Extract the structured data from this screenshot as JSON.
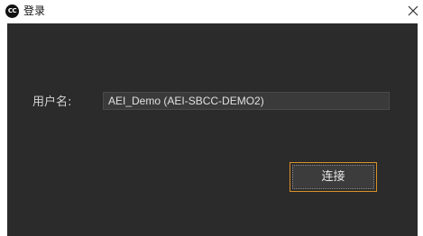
{
  "window": {
    "title": "登录",
    "app_icon_text": "CC",
    "close_icon": "close-icon"
  },
  "form": {
    "username_label": "用户名:",
    "username_value": "AEI_Demo (AEI-SBCC-DEMO2)",
    "connect_label": "连接"
  },
  "colors": {
    "panel_bg": "#2b2b2b",
    "input_bg": "#3a3a3a",
    "focus_border": "#d9902a",
    "text": "#d4d4d4"
  }
}
